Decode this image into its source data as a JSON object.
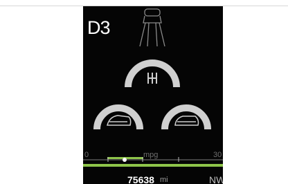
{
  "drive_mode": "D3",
  "fuel_economy": {
    "label": "mpg",
    "scale_min": "0",
    "scale_max": "30"
  },
  "odometer": {
    "value": "75638",
    "unit": "mi"
  },
  "heading": "NW",
  "icons": [
    "headlights-icon",
    "shift-pattern-icon",
    "vehicle-front-icon",
    "vehicle-rear-icon"
  ],
  "colors": {
    "screen_bg": "#050505",
    "gauge_arc": "#d0d0d0",
    "economy_bar": "#8ec54a",
    "text_primary": "#ffffff"
  }
}
